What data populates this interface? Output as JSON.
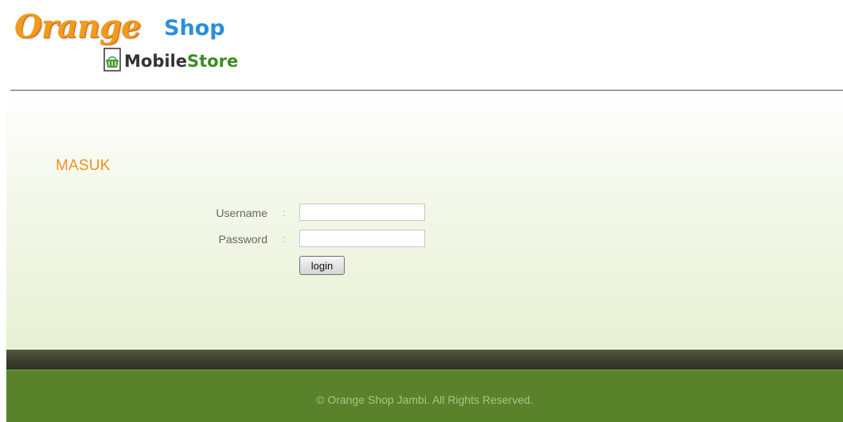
{
  "brand": {
    "logo_primary": "Orange",
    "logo_secondary": "Shop",
    "subbrand_part1": "Mobile",
    "subbrand_part2": "Store",
    "colors": {
      "orange": "#f39a1d",
      "blue": "#2b8fd6",
      "green": "#3d8c26"
    }
  },
  "login": {
    "heading": "MASUK",
    "username_label": "Username",
    "password_label": "Password",
    "separator": ":",
    "username_value": "",
    "password_value": "",
    "submit_label": "login"
  },
  "footer": {
    "copyright": "© Orange Shop Jambi. All Rights Reserved."
  },
  "icons": {
    "logo_mark": "basket-icon"
  },
  "theme": {
    "accent": "#f0901c",
    "footer_green": "#5a822a",
    "footer_dark": "#3f4230"
  }
}
